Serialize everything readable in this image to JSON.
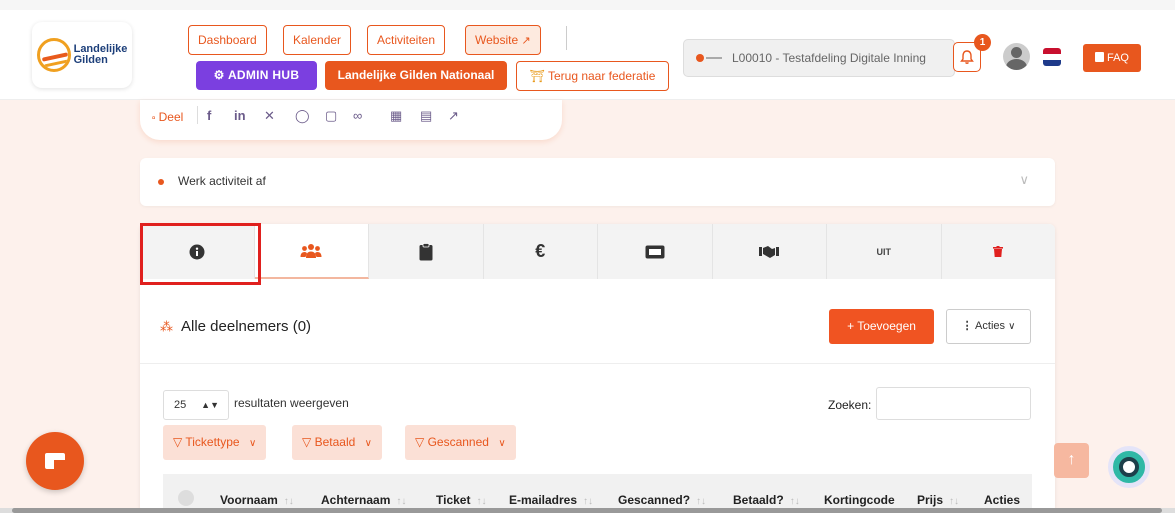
{
  "logo": {
    "line1": "Landelijke",
    "line2": "Gilden"
  },
  "nav": {
    "dashboard": "Dashboard",
    "kalender": "Kalender",
    "activiteiten": "Activiteiten",
    "website": "Website",
    "admin_hub": "ADMIN HUB",
    "nationaal": "Landelijke Gilden Nationaal",
    "terug": "Terug naar federatie"
  },
  "org_selector": "L00010 - Testafdeling Digitale Inning",
  "notifications": {
    "count": "1"
  },
  "faq": "FAQ",
  "share": {
    "label": "Deel"
  },
  "accordion": {
    "title": "Werk activiteit af"
  },
  "tabs": {
    "uit_label": "UIT",
    "items": [
      "info-icon",
      "people-icon",
      "clipboard-icon",
      "euro-icon",
      "ticket-icon",
      "handshake-icon",
      "uit-icon",
      "trash-icon"
    ]
  },
  "section": {
    "title": "Alle deelnemers (0)",
    "add_label": "+ Toevoegen",
    "acties_label": "Acties"
  },
  "table_controls": {
    "page_length": "25",
    "page_length_label": "resultaten weergeven",
    "search_label": "Zoeken:"
  },
  "filters": [
    "Tickettype",
    "Betaald",
    "Gescanned"
  ],
  "columns": [
    "Voornaam",
    "Achternaam",
    "Ticket",
    "E-mailadres",
    "Gescanned?",
    "Betaald?",
    "Kortingcode",
    "Prijs",
    "Acties"
  ],
  "colors": {
    "accent": "#e8571e",
    "admin": "#7b3fe0",
    "highlight": "#e0201e",
    "background": "#fdf1ec"
  }
}
